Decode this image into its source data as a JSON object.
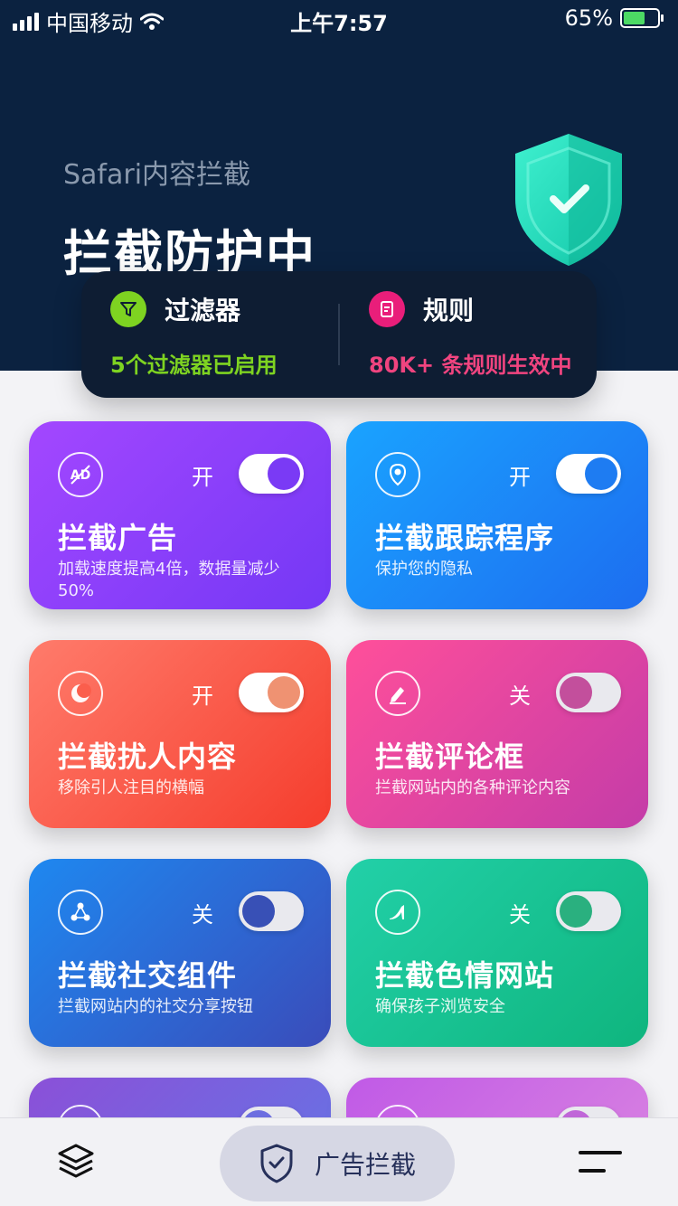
{
  "status_bar": {
    "carrier": "中国移动",
    "time": "上午7:57",
    "battery_text": "65%",
    "battery_level": 0.65
  },
  "header": {
    "subtitle": "Safari内容拦截",
    "title": "拦截防护中",
    "shield_icon": "shield-check-icon",
    "colors": {
      "background": "#0b2240",
      "shield": "#1de4c2"
    }
  },
  "stats": {
    "filters": {
      "label": "过滤器",
      "value": "5个过滤器已启用",
      "icon": "filter-icon",
      "color": "#7ed321"
    },
    "rules": {
      "label": "规则",
      "value": "80K+ 条规则生效中",
      "icon": "document-icon",
      "color": "#e91e7a"
    }
  },
  "cards": [
    {
      "title": "拦截广告",
      "desc": "加载速度提高4倍，数据量减少50%",
      "state": "开",
      "on": true,
      "icon": "ad-icon"
    },
    {
      "title": "拦截跟踪程序",
      "desc": "保护您的隐私",
      "state": "开",
      "on": true,
      "icon": "tracker-icon"
    },
    {
      "title": "拦截扰人内容",
      "desc": "移除引人注目的横幅",
      "state": "开",
      "on": true,
      "icon": "moon-icon"
    },
    {
      "title": "拦截评论框",
      "desc": "拦截网站内的各种评论内容",
      "state": "关",
      "on": false,
      "icon": "pen-icon"
    },
    {
      "title": "拦截社交组件",
      "desc": "拦截网站内的社交分享按钮",
      "state": "关",
      "on": false,
      "icon": "share-icon"
    },
    {
      "title": "拦截色情网站",
      "desc": "确保孩子浏览安全",
      "state": "关",
      "on": false,
      "icon": "heel-icon"
    }
  ],
  "tabbar": {
    "left_icon": "layers-icon",
    "center_label": "广告拦截",
    "center_icon": "shield-check-icon",
    "right_icon": "menu-icon"
  }
}
